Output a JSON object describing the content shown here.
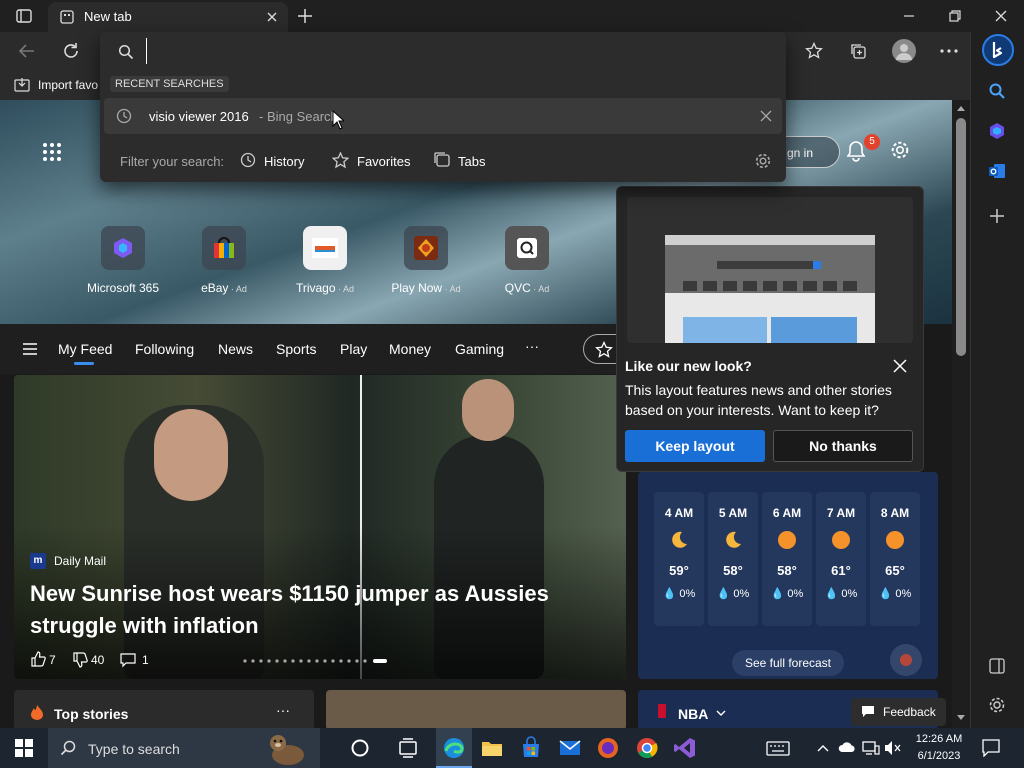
{
  "browser": {
    "tab_title": "New tab",
    "address_value": "",
    "favbar_import": "Import favo"
  },
  "omnibox": {
    "section_label": "RECENT SEARCHES",
    "suggestion_query": "visio viewer 2016",
    "suggestion_source": " - Bing Search",
    "filter_label": "Filter your search:",
    "filters": [
      "History",
      "Favorites",
      "Tabs"
    ]
  },
  "header": {
    "signin_label": "gn in",
    "notification_count": "5"
  },
  "quick_links": [
    {
      "label": "Microsoft 365",
      "ad": ""
    },
    {
      "label": "eBay",
      "ad": " · Ad"
    },
    {
      "label": "Trivago",
      "ad": " · Ad"
    },
    {
      "label": "Play Now",
      "ad": " · Ad"
    },
    {
      "label": "QVC",
      "ad": " · Ad"
    }
  ],
  "feed_nav": [
    "My Feed",
    "Following",
    "News",
    "Sports",
    "Play",
    "Money",
    "Gaming",
    "···"
  ],
  "story": {
    "source": "Daily Mail",
    "headline": "New Sunrise host wears $1150 jumper as Aussies struggle with inflation",
    "likes": "7",
    "dislikes": "40",
    "comments": "1"
  },
  "popup": {
    "title": "Like our new look?",
    "body": "This layout features news and other stories based on your interests. Want to keep it?",
    "keep_label": "Keep layout",
    "decline_label": "No thanks"
  },
  "weather": {
    "hours": [
      {
        "hour": "4 AM",
        "icon": "moon-icon",
        "temp": "59°",
        "precip": "0%"
      },
      {
        "hour": "5 AM",
        "icon": "moon-icon",
        "temp": "58°",
        "precip": "0%"
      },
      {
        "hour": "6 AM",
        "icon": "sun-icon",
        "temp": "58°",
        "precip": "0%"
      },
      {
        "hour": "7 AM",
        "icon": "sun-icon",
        "temp": "61°",
        "precip": "0%"
      },
      {
        "hour": "8 AM",
        "icon": "sun-icon",
        "temp": "65°",
        "precip": "0%"
      }
    ],
    "forecast_label": "See full forecast"
  },
  "bottom": {
    "top_stories": "Top stories",
    "nba": "NBA",
    "feedback": "Feedback"
  },
  "taskbar": {
    "search_placeholder": "Type to search",
    "time": "12:26 AM",
    "date": "6/1/2023"
  },
  "colors": {
    "accent": "#1a6fd6",
    "weather_bg": "#1b2d52"
  }
}
